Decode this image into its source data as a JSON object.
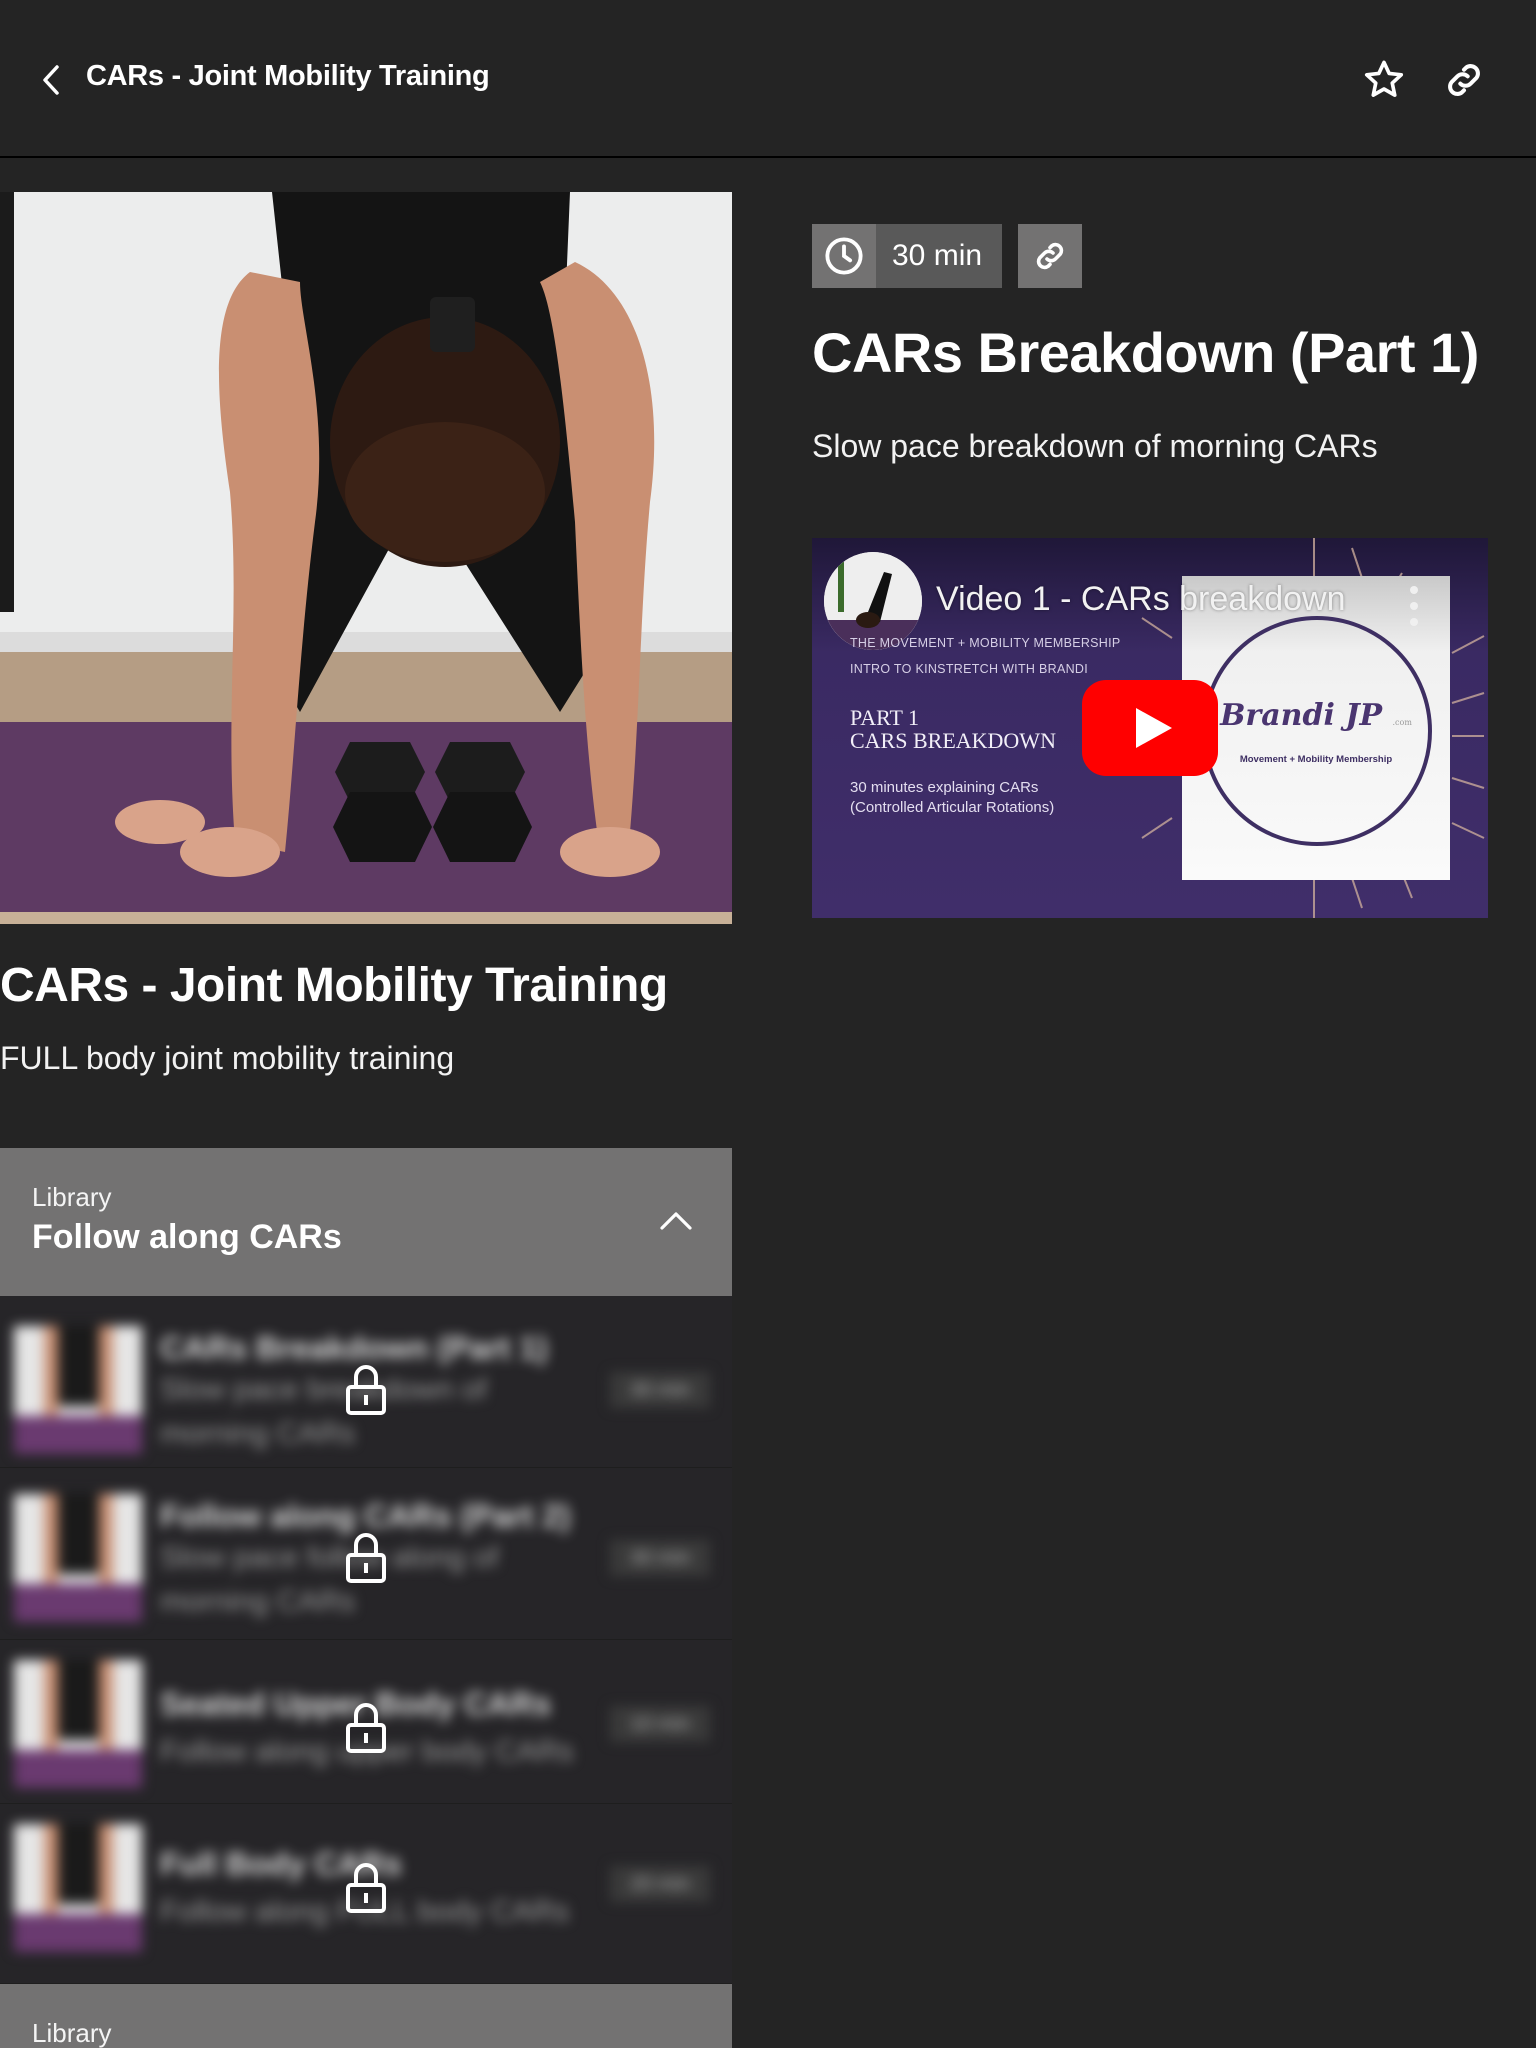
{
  "header": {
    "title": "CARs - Joint Mobility Training",
    "back_icon": "chevron-left-icon",
    "favorite_icon": "star-outline-icon",
    "share_icon": "link-icon"
  },
  "program": {
    "title": "CARs - Joint Mobility Training",
    "description": "FULL body joint mobility training",
    "hero_image_alt": "Woman in forward fold on purple mat with dumbbells"
  },
  "lesson": {
    "duration": "30 min",
    "duration_icon": "clock-icon",
    "copy_link_icon": "link-icon",
    "title": "CARs Breakdown (Part 1)",
    "description": "Slow pace breakdown of morning CARs"
  },
  "video": {
    "title": "Video 1 - CARs breakdown",
    "line1": "THE MOVEMENT + MOBILITY MEMBERSHIP",
    "line2": "INTRO TO KINSTRETCH WITH BRANDI",
    "part_line1": "PART 1",
    "part_line2": "CARS BREAKDOWN",
    "sub_line1": "30 minutes explaining CARs",
    "sub_line2": "(Controlled Articular Rotations)",
    "brand": "Brandi JP",
    "brand_suffix": ".com",
    "membership": "Movement + Mobility Membership",
    "play_icon": "youtube-play-icon",
    "menu_icon": "more-vertical-icon",
    "accent_color": "#ff0000"
  },
  "libraries": [
    {
      "label": "Library",
      "name": "Follow along CARs",
      "expanded": true,
      "items": [
        {
          "title": "CARs Breakdown (Part 1)",
          "description": "Slow pace breakdown of morning CARs",
          "duration": "30 min",
          "locked": true
        },
        {
          "title": "Follow along CARs (Part 2)",
          "description": "Slow pace follow along of morning CARs",
          "duration": "30 min",
          "locked": true
        },
        {
          "title": "Seated Upper Body CARs",
          "description": "Follow along upper body CARs",
          "duration": "10 min",
          "locked": true
        },
        {
          "title": "Full Body CARs",
          "description": "Follow along FULL body CARs",
          "duration": "20 min",
          "locked": true
        }
      ]
    },
    {
      "label": "Library"
    }
  ],
  "colors": {
    "background": "#242424",
    "library_header": "#737272",
    "badge_icon_bg": "#737272",
    "badge_text_bg": "#595959"
  }
}
